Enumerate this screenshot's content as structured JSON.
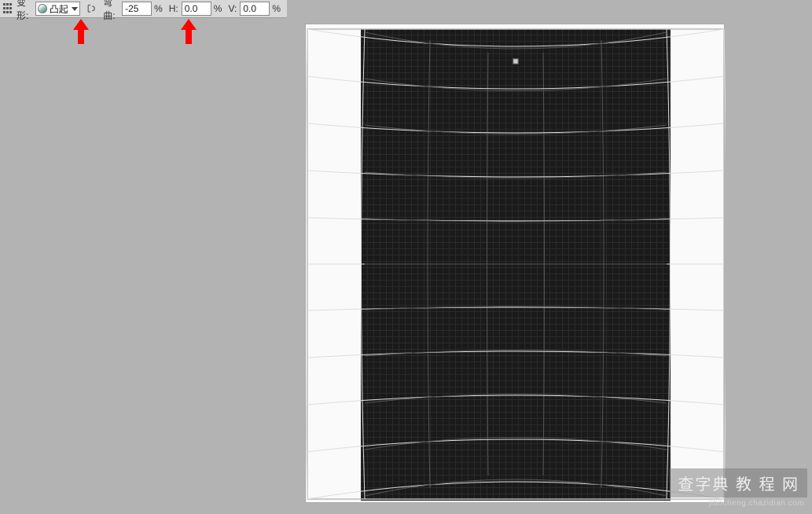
{
  "toolbar": {
    "warp_label": "变形:",
    "warp_style": "凸起",
    "bend_label": "弯曲:",
    "bend_value": "-25",
    "h_label": "H:",
    "h_value": "0.0",
    "v_label": "V:",
    "v_value": "0.0",
    "percent": "%"
  },
  "watermark": {
    "main": "查字典 教 程 网",
    "sub": "jiaocheng.chazidian.com"
  }
}
